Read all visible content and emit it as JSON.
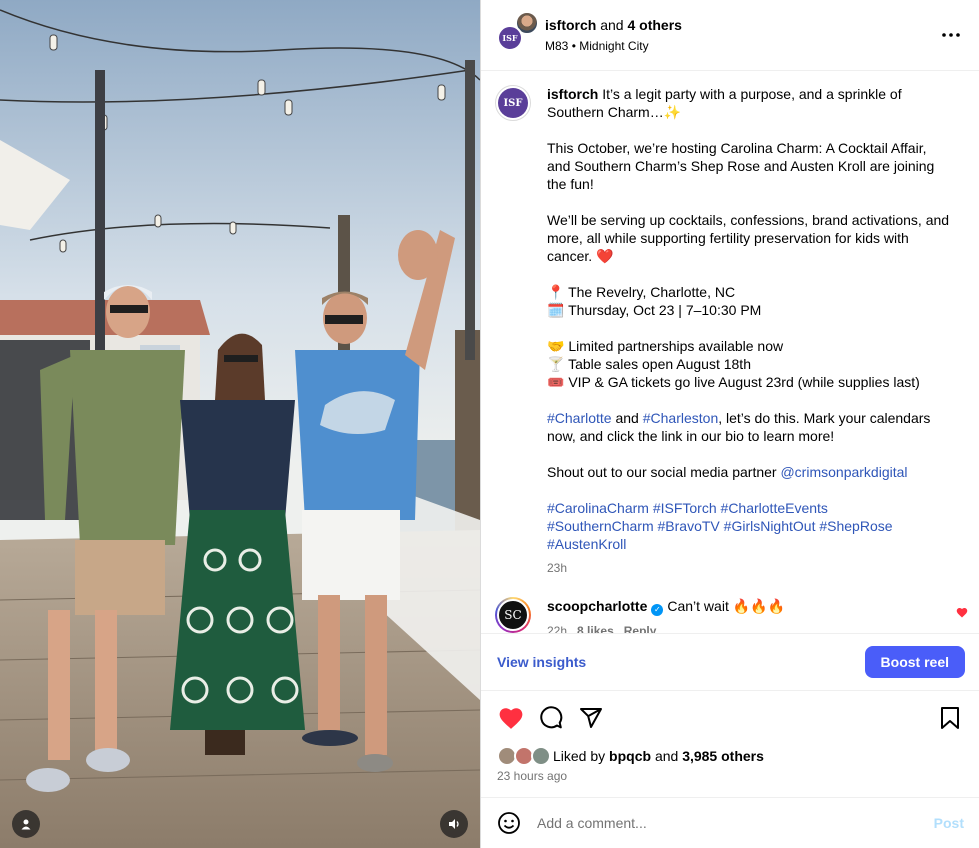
{
  "header": {
    "username": "isftorch",
    "and_text": "and",
    "others": "4 others",
    "audio_artist": "M83",
    "separator": "•",
    "audio_track": "Midnight City",
    "avatar_text": "ISF"
  },
  "caption": {
    "avatar_text": "ISF",
    "username": "isftorch",
    "line1": "It’s a legit party with a purpose, and a sprinkle of Southern Charm…✨",
    "p2": "This October, we’re hosting Carolina Charm: A Cocktail Affair, and Southern Charm’s Shep Rose and Austen Kroll are joining the fun!",
    "p3": "We’ll be serving up cocktails, confessions, brand activations, and more, all while supporting fertility preservation for kids with cancer. ❤️",
    "location": "📍 The Revelry, Charlotte, NC",
    "date": "🗓️ Thursday, Oct 23 | 7–10:30 PM",
    "partnerships": "🤝 Limited partnerships available now",
    "tables": "🍸 Table sales open August 18th",
    "tickets": "🎟️ VIP & GA tickets go live August 23rd (while supplies last)",
    "tag_charlotte": "#Charlotte",
    "and_word": "and",
    "tag_charleston": "#Charleston",
    "cta": ", let’s do this. Mark your calendars now, and click the link in our bio to learn more!",
    "shoutout": "Shout out to our social media partner",
    "partner": "@crimsonparkdigital",
    "hashtags": [
      "#CarolinaCharm",
      "#ISFTorch",
      "#CharlotteEvents",
      "#SouthernCharm",
      "#BravoTV",
      "#GirlsNightOut",
      "#ShepRose",
      "#AustenKroll"
    ],
    "time": "23h"
  },
  "comment": {
    "avatar_text": "SC",
    "username": "scoopcharlotte",
    "text": "Can’t wait 🔥🔥🔥",
    "time": "22h",
    "likes": "8 likes",
    "reply": "Reply"
  },
  "insights": {
    "view_label": "View insights",
    "boost_label": "Boost reel"
  },
  "engagement": {
    "liked_by": "Liked by",
    "liker": "bpqcb",
    "and_word": "and",
    "others": "3,985 others",
    "posted_ago": "23 hours ago"
  },
  "comment_box": {
    "placeholder": "Add a comment...",
    "post_label": "Post"
  },
  "icons": {
    "more": "more-options-icon",
    "like": "heart-icon",
    "comment": "comment-icon",
    "share": "share-icon",
    "save": "bookmark-icon",
    "emoji": "emoji-icon",
    "user": "user-tag-icon",
    "sound": "sound-icon"
  },
  "colors": {
    "accent": "#4a5df9",
    "link": "#2f56b8",
    "like_red": "#ff3040",
    "muted": "#737373"
  }
}
